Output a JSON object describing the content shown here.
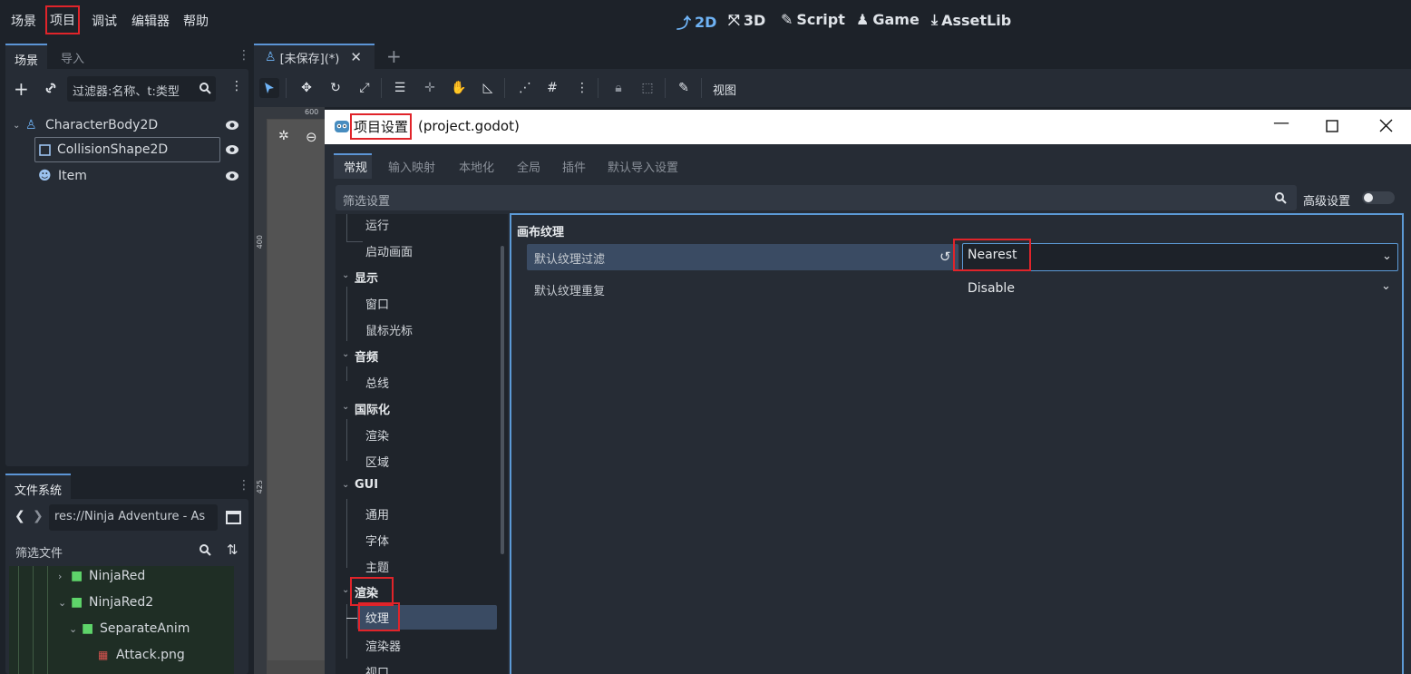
{
  "menu": [
    "场景",
    "项目",
    "调试",
    "编辑器",
    "帮助"
  ],
  "modes": [
    "2D",
    "3D",
    "Script",
    "Game",
    "AssetLib"
  ],
  "scene_dock": {
    "tabs": [
      "场景",
      "导入"
    ],
    "filter_placeholder": "过滤器:名称、t:类型",
    "nodes": [
      {
        "label": "CharacterBody2D"
      },
      {
        "label": "CollisionShape2D"
      },
      {
        "label": "Item"
      }
    ]
  },
  "fs_dock": {
    "tab": "文件系统",
    "path": "res://Ninja Adventure - As",
    "filter_placeholder": "筛选文件",
    "items": [
      {
        "label": "NinjaRed"
      },
      {
        "label": "NinjaRed2"
      },
      {
        "label": "SeparateAnim"
      },
      {
        "label": "Attack.png"
      }
    ]
  },
  "editor": {
    "tab_label": "[未保存](*)",
    "view_label": "视图",
    "ruler_top": "600",
    "ruler_left": [
      "400",
      "425"
    ]
  },
  "dialog": {
    "title": "项目设置",
    "subtitle": "(project.godot)",
    "tabs": [
      "常规",
      "输入映射",
      "本地化",
      "全局",
      "插件",
      "默认导入设置"
    ],
    "filter_placeholder": "筛选设置",
    "advanced_label": "高级设置",
    "sidebar": [
      {
        "label": "运行"
      },
      {
        "label": "启动画面"
      },
      {
        "label": "显示"
      },
      {
        "label": "窗口"
      },
      {
        "label": "鼠标光标"
      },
      {
        "label": "音频"
      },
      {
        "label": "总线"
      },
      {
        "label": "国际化"
      },
      {
        "label": "渲染"
      },
      {
        "label": "区域"
      },
      {
        "label": "GUI"
      },
      {
        "label": "通用"
      },
      {
        "label": "字体"
      },
      {
        "label": "主题"
      },
      {
        "label": "渲染"
      },
      {
        "label": "纹理"
      },
      {
        "label": "渲染器"
      },
      {
        "label": "视口"
      }
    ],
    "section_title": "画布纹理",
    "properties": [
      {
        "label": "默认纹理过滤",
        "value": "Nearest"
      },
      {
        "label": "默认纹理重复",
        "value": "Disable"
      }
    ]
  },
  "colors": {
    "accent": "#6fb3f5",
    "highlight": "#e0242a",
    "selected_row": "#3a4b63"
  }
}
